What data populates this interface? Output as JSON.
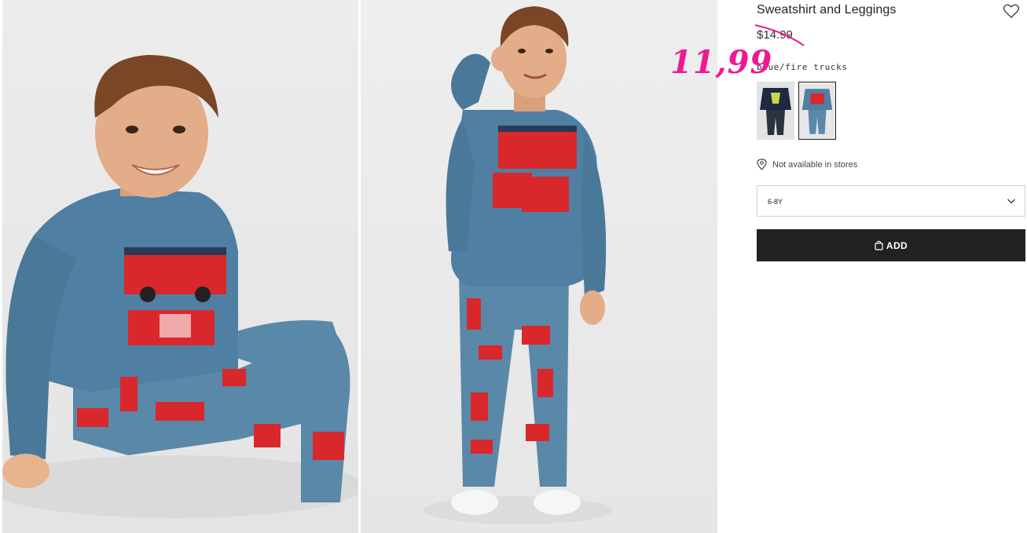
{
  "product": {
    "title": "Sweatshirt and Leggings",
    "old_price": "$14.99",
    "sale_price": "11,99",
    "color_name": "blue/fire trucks",
    "store_availability": "Not available in stores",
    "size_selected": "6-8Y",
    "add_label": "ADD"
  },
  "colors": {
    "sale": "#f01890",
    "sweatshirt": "#4f7fa2",
    "button": "#222222",
    "truck": "#d8282c"
  },
  "icons": {
    "wishlist": "heart-outline-icon",
    "store": "location-pin-icon",
    "dropdown": "chevron-down-icon",
    "add": "shopping-bag-icon"
  },
  "swatches": [
    {
      "name": "navy-dinosaur",
      "selected": false
    },
    {
      "name": "blue-fire-trucks",
      "selected": true
    }
  ]
}
